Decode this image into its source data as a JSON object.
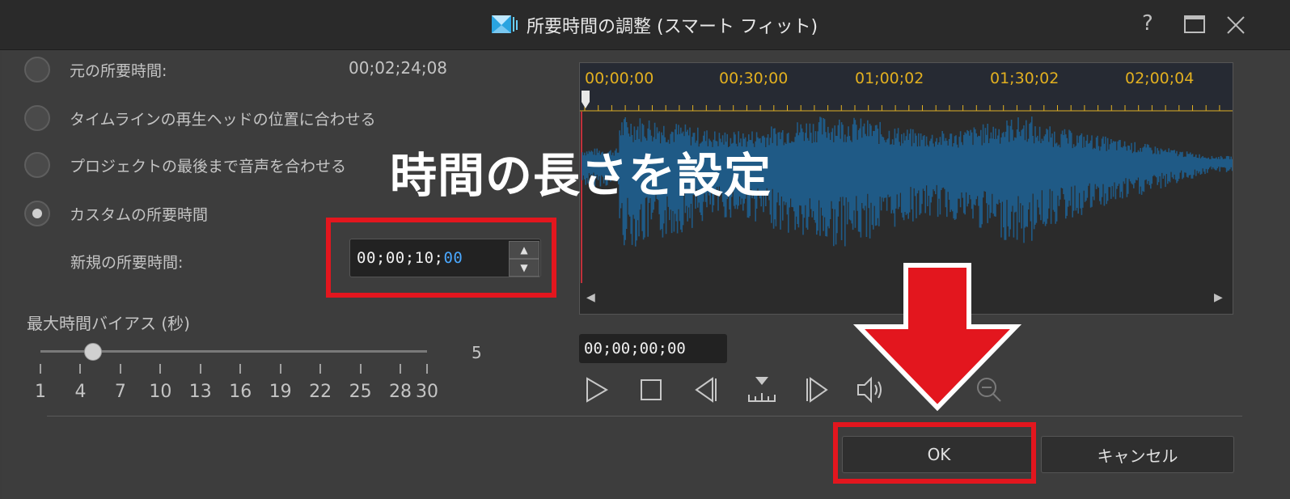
{
  "window": {
    "title": "所要時間の調整 (スマート フィット)",
    "help_icon": "?"
  },
  "options": [
    {
      "label": "元の所要時間:",
      "checked": false,
      "value": "00;02;24;08"
    },
    {
      "label": "タイムラインの再生ヘッドの位置に合わせる",
      "checked": false
    },
    {
      "label": "プロジェクトの最後まで音声を合わせる",
      "checked": false
    },
    {
      "label": "カスタムの所要時間",
      "checked": true
    }
  ],
  "new_duration": {
    "label": "新規の所要時間:",
    "value_main": "00;00;10;",
    "value_selected": "00"
  },
  "bias": {
    "label": "最大時間バイアス (秒)",
    "value": "5",
    "ticks": [
      "1",
      "4",
      "7",
      "10",
      "13",
      "16",
      "19",
      "22",
      "25",
      "28",
      "30"
    ]
  },
  "overlay": {
    "text": "時間の長さを設定"
  },
  "ruler": {
    "labels": [
      "00;00;00",
      "00;30;00",
      "01;00;02",
      "01;30;02",
      "02;00;04"
    ]
  },
  "position": {
    "value": "00;00;00;00"
  },
  "buttons": {
    "ok": "OK",
    "cancel": "キャンセル"
  },
  "colors": {
    "accent_red": "#e3161e",
    "waveform": "#1f5a86",
    "ruler_text": "#e2b020",
    "timecode_selected": "#4aa8ff"
  }
}
